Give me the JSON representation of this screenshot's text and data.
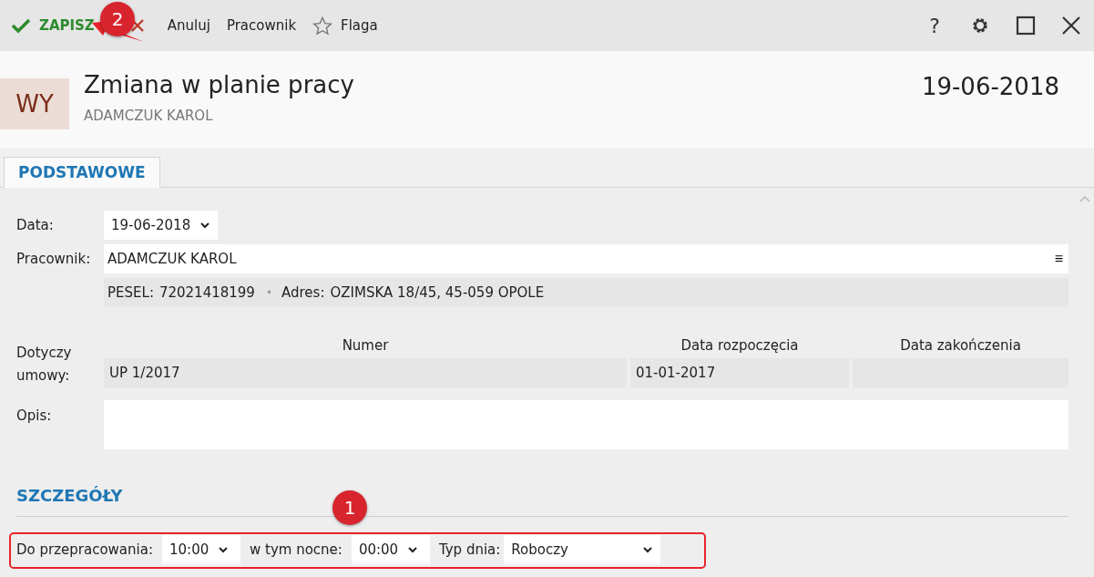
{
  "toolbar": {
    "actions": [
      {
        "kind": "save",
        "label": "ZAPISZ"
      },
      {
        "kind": "cancel",
        "label": "Anuluj"
      },
      {
        "kind": "plain",
        "label": "Pracownik"
      },
      {
        "kind": "flag",
        "label": "Flaga"
      }
    ],
    "window_controls": [
      {
        "kind": "help",
        "label": "?"
      },
      {
        "kind": "settings"
      },
      {
        "kind": "maximize"
      },
      {
        "kind": "close"
      }
    ]
  },
  "header": {
    "badge": "WY",
    "title": "Zmiana w planie pracy",
    "subtitle": "ADAMCZUK KAROL",
    "date": "19-06-2018"
  },
  "tabs": [
    {
      "label": "PODSTAWOWE",
      "selected": true
    }
  ],
  "form": {
    "date_label": "Data:",
    "date_value": "19-06-2018",
    "employee_label": "Pracownik:",
    "employee_value": "ADAMCZUK KAROL",
    "employee_menu": "≡",
    "pesel_label": "PESEL:",
    "pesel_value": "72021418199",
    "separator": "•",
    "address_label": "Adres:",
    "address_value": "OZIMSKA 18/45, 45-059 OPOLE",
    "contract_label": "Dotyczy umowy:",
    "contract_table": {
      "columns": [
        "Numer",
        "Data rozpoczęcia",
        "Data zakończenia"
      ],
      "rows": [
        [
          "UP 1/2017",
          "01-01-2017",
          ""
        ]
      ]
    },
    "description_label": "Opis:"
  },
  "details": {
    "heading": "SZCZEGÓŁY",
    "fields": [
      {
        "label": "Do przepracowania:",
        "value": "10:00"
      },
      {
        "label": "w tym nocne:",
        "value": "00:00"
      },
      {
        "label": "Typ dnia:",
        "value": "Roboczy"
      }
    ]
  },
  "annotations": [
    {
      "kind": "arrow_callout",
      "number": "2"
    },
    {
      "kind": "frame_callout",
      "number": "1"
    }
  ]
}
